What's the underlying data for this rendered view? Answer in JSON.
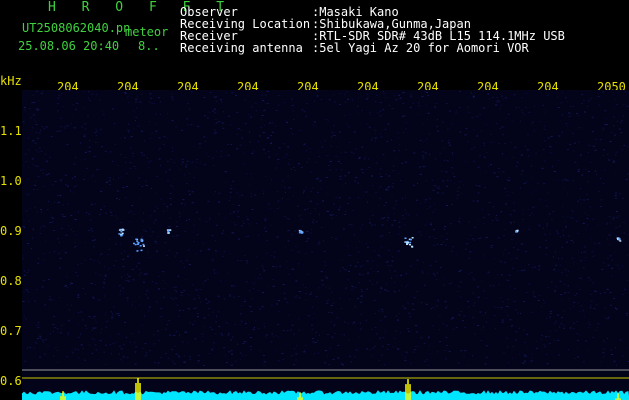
{
  "header": {
    "title": "H R O F F T",
    "filename": "UT2508062040.pn",
    "tag": "meteor",
    "timestamp": "25.08.06 20:40",
    "counter": "8..",
    "fields": [
      {
        "label": "Observer",
        "value": ":Masaki Kano"
      },
      {
        "label": "Receiving Location",
        "value": ":Shibukawa,Gunma,Japan"
      },
      {
        "label": "Receiver",
        "value": ":RTL-SDR SDR# 43dB L15 114.1MHz USB"
      },
      {
        "label": "Receiving antenna",
        "value": ":5el Yagi Az 20 for Aomori VOR"
      }
    ]
  },
  "axes": {
    "y_unit": "kHz",
    "x_ticks": [
      "204",
      "204",
      "204",
      "204",
      "204",
      "204",
      "204",
      "204",
      "204",
      "2050"
    ],
    "y_ticks": [
      "1.1",
      "1.0",
      "0.9",
      "0.8",
      "0.7",
      "0.6"
    ]
  },
  "colors": {
    "background": "#000000",
    "noise": "#141a5a",
    "label_yellow": "#e6e000",
    "header_green": "#3fd23f",
    "echo": "#5aa0ff",
    "trace": "#00e6ff",
    "spike": "#ffff00"
  },
  "echoes": [
    {
      "minute": 1.3,
      "khz": 0.872,
      "strength": 1.0
    },
    {
      "minute": 1.0,
      "khz": 0.9,
      "strength": 0.6
    },
    {
      "minute": 5.8,
      "khz": 0.88,
      "strength": 0.8
    },
    {
      "minute": 4.0,
      "khz": 0.9,
      "strength": 0.3
    },
    {
      "minute": 9.3,
      "khz": 0.885,
      "strength": 0.3
    },
    {
      "minute": 1.8,
      "khz": 0.9,
      "strength": 0.3
    },
    {
      "minute": 7.6,
      "khz": 0.9,
      "strength": 0.2
    }
  ],
  "spikes": [
    {
      "minute": 1.3,
      "level": 1.0
    },
    {
      "minute": 5.8,
      "level": 0.95
    },
    {
      "minute": 0.05,
      "level": 0.4
    },
    {
      "minute": 4.0,
      "level": 0.35
    },
    {
      "minute": 9.3,
      "level": 0.3
    }
  ]
}
